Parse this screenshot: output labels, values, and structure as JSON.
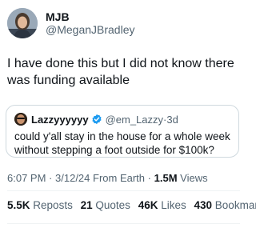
{
  "author": {
    "name": "MJB",
    "handle": "@MeganJBradley"
  },
  "tweet": {
    "text": "I have done this but I did not know there was funding available"
  },
  "quoted": {
    "name": "Lazzyyyyyy",
    "handle": "@em_Lazzy",
    "separator": "·",
    "time": "3d",
    "text": "could y'all stay in the house for a whole week without stepping a foot outside for $100k?"
  },
  "meta": {
    "time": "6:07 PM",
    "date": "3/12/24",
    "source": "From Earth",
    "dot": "·",
    "views_count": "1.5M",
    "views_label": "Views"
  },
  "stats": {
    "reposts_count": "5.5K",
    "reposts_label": "Reposts",
    "quotes_count": "21",
    "quotes_label": "Quotes",
    "likes_count": "46K",
    "likes_label": "Likes",
    "bookmarks_count": "430",
    "bookmarks_label": "Bookmarks"
  },
  "colors": {
    "text": "#0f1419",
    "secondary": "#536471",
    "verified": "#1d9bf0",
    "border": "#cfd9de"
  },
  "icons": [
    "avatar",
    "verified-badge-icon"
  ]
}
